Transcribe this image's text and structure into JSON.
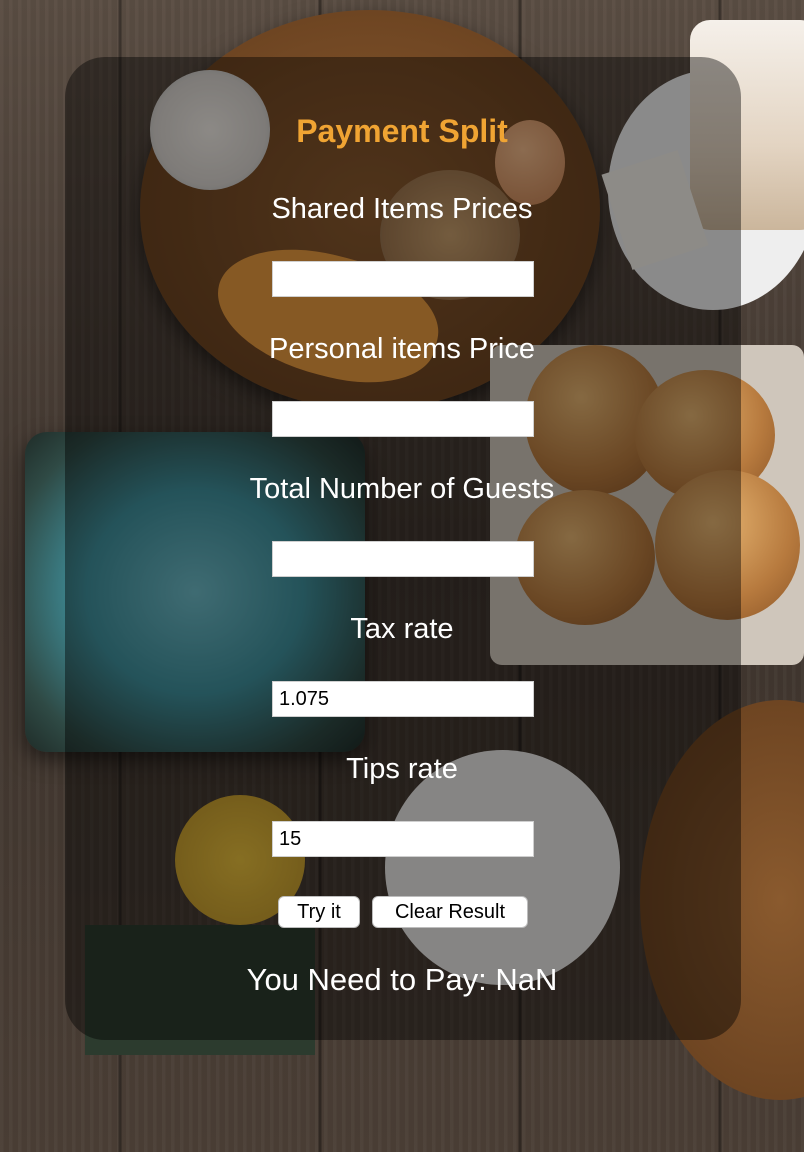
{
  "app": {
    "title": "Payment Split"
  },
  "fields": {
    "shared": {
      "label": "Shared Items Prices",
      "value": ""
    },
    "personal": {
      "label": "Personal items Price",
      "value": ""
    },
    "guests": {
      "label": "Total Number of Guests",
      "value": ""
    },
    "tax": {
      "label": "Tax rate",
      "value": "1.075"
    },
    "tips": {
      "label": "Tips rate",
      "value": "15"
    }
  },
  "buttons": {
    "try_label": "Try it",
    "clear_label": "Clear Result"
  },
  "result": {
    "text": "You Need to Pay: NaN"
  }
}
